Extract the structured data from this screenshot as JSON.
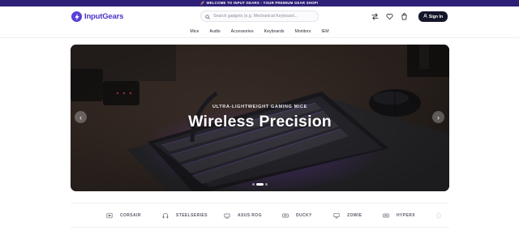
{
  "announcement": {
    "text": "🚀 WELCOME TO INPUT GEARS - YOUR PREMIUM GEAR SHOP!"
  },
  "header": {
    "logo_text": "InputGears",
    "search_placeholder": "Search gadgets (e.g. Mechanical Keyboard...",
    "signin_label": "Sign In",
    "icons": [
      "compare-icon",
      "heart-icon",
      "cart-icon"
    ]
  },
  "nav": {
    "items": [
      "Mice",
      "Audio",
      "Accessories",
      "Keyboards",
      "Monitors",
      "IEM"
    ]
  },
  "hero": {
    "subtitle": "ULTRA-LIGHTWEIGHT GAMING MICE",
    "title": "Wireless Precision",
    "prev_label": "‹",
    "next_label": "›",
    "slides": 3,
    "active_slide": 2
  },
  "brands": {
    "items": [
      "CORSAIR",
      "STEELSERIES",
      "ASUS ROG",
      "DUCKY",
      "ZOWIE",
      "HYPERX"
    ]
  },
  "colors": {
    "brand": "#4b35c7",
    "topbar": "#2e1f78",
    "signin_bg": "#14162a"
  }
}
